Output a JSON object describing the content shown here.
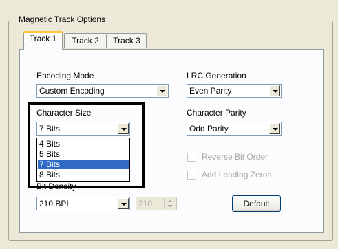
{
  "group": {
    "title": "Magnetic Track Options"
  },
  "tabs": [
    {
      "label": "Track 1",
      "active": true
    },
    {
      "label": "Track 2",
      "active": false
    },
    {
      "label": "Track 3",
      "active": false
    }
  ],
  "encoding_mode": {
    "label": "Encoding Mode",
    "value": "Custom Encoding"
  },
  "lrc_generation": {
    "label": "LRC Generation",
    "value": "Even Parity"
  },
  "character_size": {
    "label": "Character Size",
    "value": "7 Bits",
    "options": [
      "4 Bits",
      "5 Bits",
      "7 Bits",
      "8 Bits"
    ],
    "selected_index": 2
  },
  "character_parity": {
    "label": "Character Parity",
    "value": "Odd Parity"
  },
  "reverse_bit_order": {
    "label": "Reverse Bit Order",
    "checked": false,
    "enabled": false
  },
  "add_leading_zeros": {
    "label": "Add Leading Zeros",
    "checked": false,
    "enabled": false
  },
  "bit_density": {
    "label": "Bit Density",
    "value": "210 BPI"
  },
  "spin": {
    "value": "210"
  },
  "default_button": {
    "label": "Default"
  },
  "colors": {
    "selection": "#316ac5",
    "highlight_box": "#000000",
    "background": "#ece9d8"
  }
}
